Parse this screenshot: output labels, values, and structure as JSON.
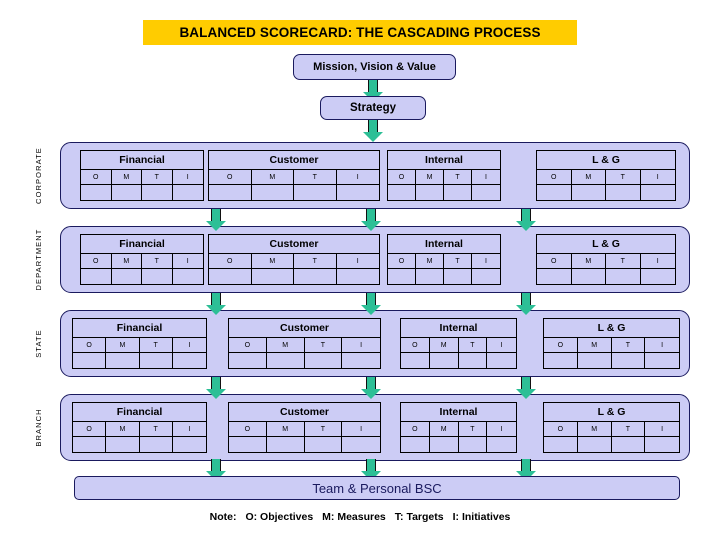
{
  "title": {
    "text": "BALANCED SCORECARD: THE CASCADING PROCESS",
    "banner_color": "#FFCC00"
  },
  "top_boxes": {
    "mission": "Mission, Vision & Value",
    "strategy": "Strategy"
  },
  "colors": {
    "box_fill": "#CCCCF5",
    "box_border": "#1A1A5E",
    "arrow_fill": "#2DBF96",
    "table_border": "#000000",
    "title_banner": "#FFCC00"
  },
  "columns": [
    "O",
    "M",
    "T",
    "I"
  ],
  "perspectives": [
    "Financial",
    "Customer",
    "Internal",
    "L & G"
  ],
  "levels": [
    {
      "label": "CORPORATE",
      "perspectives": [
        {
          "name": "Financial",
          "cells": [
            "O",
            "M",
            "T",
            "I"
          ],
          "values": [
            "",
            "",
            "",
            ""
          ]
        },
        {
          "name": "Customer",
          "cells": [
            "O",
            "M",
            "T",
            "I"
          ],
          "values": [
            "",
            "",
            "",
            ""
          ]
        },
        {
          "name": "Internal",
          "cells": [
            "O",
            "M",
            "T",
            "I"
          ],
          "values": [
            "",
            "",
            "",
            ""
          ]
        },
        {
          "name": "L & G",
          "cells": [
            "O",
            "M",
            "T",
            "I"
          ],
          "values": [
            "",
            "",
            "",
            ""
          ]
        }
      ]
    },
    {
      "label": "DEPARTMENT",
      "perspectives": [
        {
          "name": "Financial",
          "cells": [
            "O",
            "M",
            "T",
            "I"
          ],
          "values": [
            "",
            "",
            "",
            ""
          ]
        },
        {
          "name": "Customer",
          "cells": [
            "O",
            "M",
            "T",
            "I"
          ],
          "values": [
            "",
            "",
            "",
            ""
          ]
        },
        {
          "name": "Internal",
          "cells": [
            "O",
            "M",
            "T",
            "I"
          ],
          "values": [
            "",
            "",
            "",
            ""
          ]
        },
        {
          "name": "L & G",
          "cells": [
            "O",
            "M",
            "T",
            "I"
          ],
          "values": [
            "",
            "",
            "",
            ""
          ]
        }
      ]
    },
    {
      "label": "STATE",
      "perspectives": [
        {
          "name": "Financial",
          "cells": [
            "O",
            "M",
            "T",
            "I"
          ],
          "values": [
            "",
            "",
            "",
            ""
          ]
        },
        {
          "name": "Customer",
          "cells": [
            "O",
            "M",
            "T",
            "I"
          ],
          "values": [
            "",
            "",
            "",
            ""
          ]
        },
        {
          "name": "Internal",
          "cells": [
            "O",
            "M",
            "T",
            "I"
          ],
          "values": [
            "",
            "",
            "",
            ""
          ]
        },
        {
          "name": "L & G",
          "cells": [
            "O",
            "M",
            "T",
            "I"
          ],
          "values": [
            "",
            "",
            "",
            ""
          ]
        }
      ]
    },
    {
      "label": "BRANCH",
      "perspectives": [
        {
          "name": "Financial",
          "cells": [
            "O",
            "M",
            "T",
            "I"
          ],
          "values": [
            "",
            "",
            "",
            ""
          ]
        },
        {
          "name": "Customer",
          "cells": [
            "O",
            "M",
            "T",
            "I"
          ],
          "values": [
            "",
            "",
            "",
            ""
          ]
        },
        {
          "name": "Internal",
          "cells": [
            "O",
            "M",
            "T",
            "I"
          ],
          "values": [
            "",
            "",
            "",
            ""
          ]
        },
        {
          "name": "L & G",
          "cells": [
            "O",
            "M",
            "T",
            "I"
          ],
          "values": [
            "",
            "",
            "",
            ""
          ]
        }
      ]
    }
  ],
  "bottom": {
    "team_bsc": "Team & Personal BSC"
  },
  "note": {
    "prefix": "Note:",
    "items": [
      "O: Objectives",
      "M: Measures",
      "T: Targets",
      "I: Initiatives"
    ]
  }
}
